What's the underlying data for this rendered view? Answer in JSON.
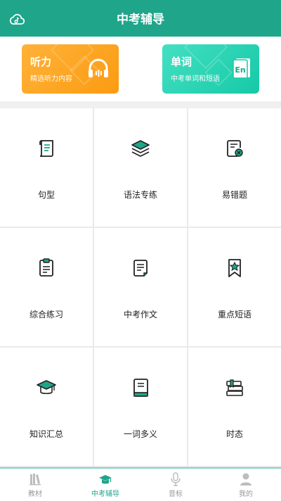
{
  "header": {
    "title": "中考辅导",
    "logo_icon": "cloud-note-icon"
  },
  "banners": [
    {
      "title": "听力",
      "subtitle": "精选听力内容",
      "icon": "headphones-icon"
    },
    {
      "title": "单词",
      "subtitle": "中考单词和短语",
      "icon": "en-book-icon",
      "badge": "En"
    }
  ],
  "grid": [
    {
      "label": "句型",
      "icon": "scroll-icon"
    },
    {
      "label": "语法专练",
      "icon": "layers-icon"
    },
    {
      "label": "易错题",
      "icon": "wrong-doc-icon"
    },
    {
      "label": "综合练习",
      "icon": "clipboard-icon"
    },
    {
      "label": "中考作文",
      "icon": "essay-doc-icon"
    },
    {
      "label": "重点短语",
      "icon": "star-bookmark-icon"
    },
    {
      "label": "知识汇总",
      "icon": "graduation-cap-icon"
    },
    {
      "label": "一词多义",
      "icon": "book-icon"
    },
    {
      "label": "时态",
      "icon": "books-stack-icon"
    }
  ],
  "tabs": [
    {
      "label": "教材",
      "icon": "textbook-icon",
      "active": false
    },
    {
      "label": "中考辅导",
      "icon": "graduation-cap-icon",
      "active": true
    },
    {
      "label": "音标",
      "icon": "microphone-icon",
      "active": false
    },
    {
      "label": "我的",
      "icon": "user-icon",
      "active": false
    }
  ],
  "colors": {
    "primary": "#1fa58a",
    "orange": "#fb9b12",
    "teal": "#16c9a6",
    "tab_inactive": "#999999"
  }
}
